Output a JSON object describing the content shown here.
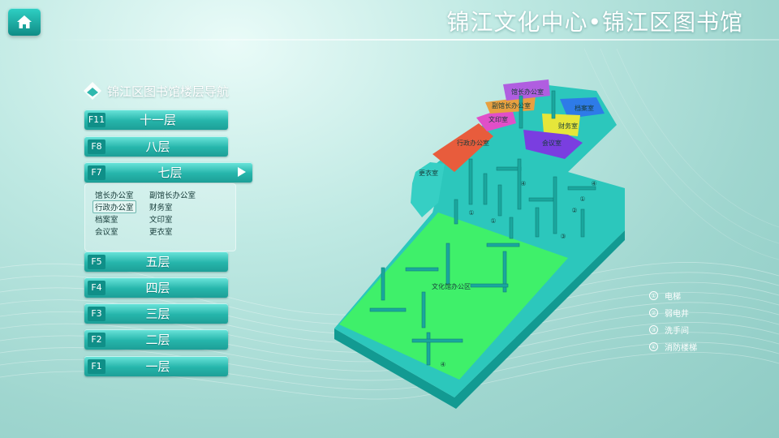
{
  "header": {
    "title": "锦江文化中心•锦江区图书馆",
    "home_icon": "home-icon"
  },
  "nav": {
    "title": "锦江区图书馆楼层导航",
    "floors": [
      {
        "code": "F11",
        "name": "十一层"
      },
      {
        "code": "F8",
        "name": "八层"
      },
      {
        "code": "F7",
        "name": "七层",
        "active": true
      },
      {
        "code": "F5",
        "name": "五层"
      },
      {
        "code": "F4",
        "name": "四层"
      },
      {
        "code": "F3",
        "name": "三层"
      },
      {
        "code": "F2",
        "name": "二层"
      },
      {
        "code": "F1",
        "name": "一层"
      }
    ],
    "rooms": [
      "馆长办公室",
      "副馆长办公室",
      "行政办公室",
      "财务室",
      "档案室",
      "文印室",
      "会议室",
      "更衣室"
    ],
    "selected_room": "行政办公室"
  },
  "map": {
    "labels": {
      "director": "馆长办公室",
      "vice_director": "副馆长办公室",
      "archive": "档案室",
      "print": "文印室",
      "finance": "财务室",
      "meeting": "会议室",
      "admin": "行政办公室",
      "locker": "更衣室",
      "office_area": "文化馆办公区"
    },
    "markers": [
      "④",
      "④",
      "①",
      "①",
      "①",
      "②",
      "③",
      "④"
    ],
    "colors": {
      "admin": "#e85c3c",
      "vice_director": "#e8a040",
      "director": "#b05ee0",
      "print": "#e04fc8",
      "archive": "#2e7be8",
      "finance": "#e6e63a",
      "meeting": "#7a3ee0",
      "office": "#3ff06a",
      "wall": "#26c4ba"
    }
  },
  "legend": [
    {
      "num": "①",
      "label": "电梯"
    },
    {
      "num": "②",
      "label": "弱电井"
    },
    {
      "num": "③",
      "label": "洗手间"
    },
    {
      "num": "④",
      "label": "消防楼梯"
    }
  ]
}
